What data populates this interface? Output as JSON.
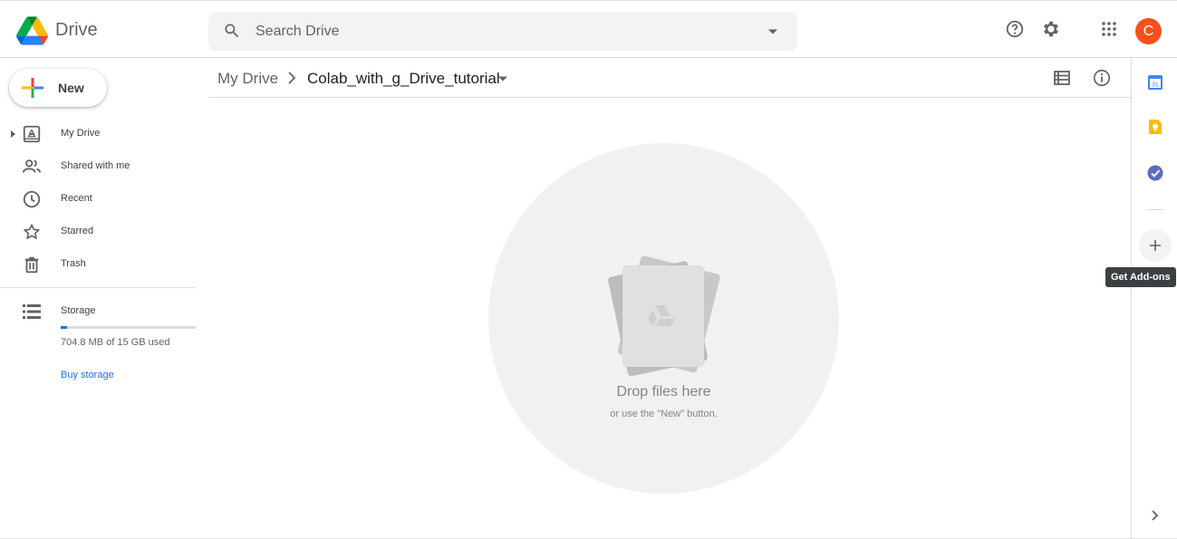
{
  "header": {
    "app_title": "Drive",
    "search_placeholder": "Search Drive",
    "avatar_letter": "C",
    "avatar_color": "#f4511e"
  },
  "sidebar": {
    "new_label": "New",
    "items": [
      {
        "label": "My Drive",
        "icon": "my-drive-icon"
      },
      {
        "label": "Shared with me",
        "icon": "people-icon"
      },
      {
        "label": "Recent",
        "icon": "clock-icon"
      },
      {
        "label": "Starred",
        "icon": "star-icon"
      },
      {
        "label": "Trash",
        "icon": "trash-icon"
      }
    ],
    "storage": {
      "label": "Storage",
      "used_text": "704.8 MB of 15 GB used",
      "used_fraction": 0.047,
      "buy_label": "Buy storage"
    }
  },
  "breadcrumb": {
    "root": "My Drive",
    "current": "Colab_with_g_Drive_tutorial"
  },
  "drop_zone": {
    "title": "Drop files here",
    "subtitle": "or use the \"New\" button."
  },
  "right_rail": {
    "apps": [
      "calendar-icon",
      "keep-icon",
      "tasks-icon"
    ],
    "add_tooltip": "Get Add-ons"
  },
  "colors": {
    "accent": "#1a73e8",
    "calendar": "#4285f4",
    "keep": "#fbbc04",
    "tasks": "#5c6bc0"
  }
}
